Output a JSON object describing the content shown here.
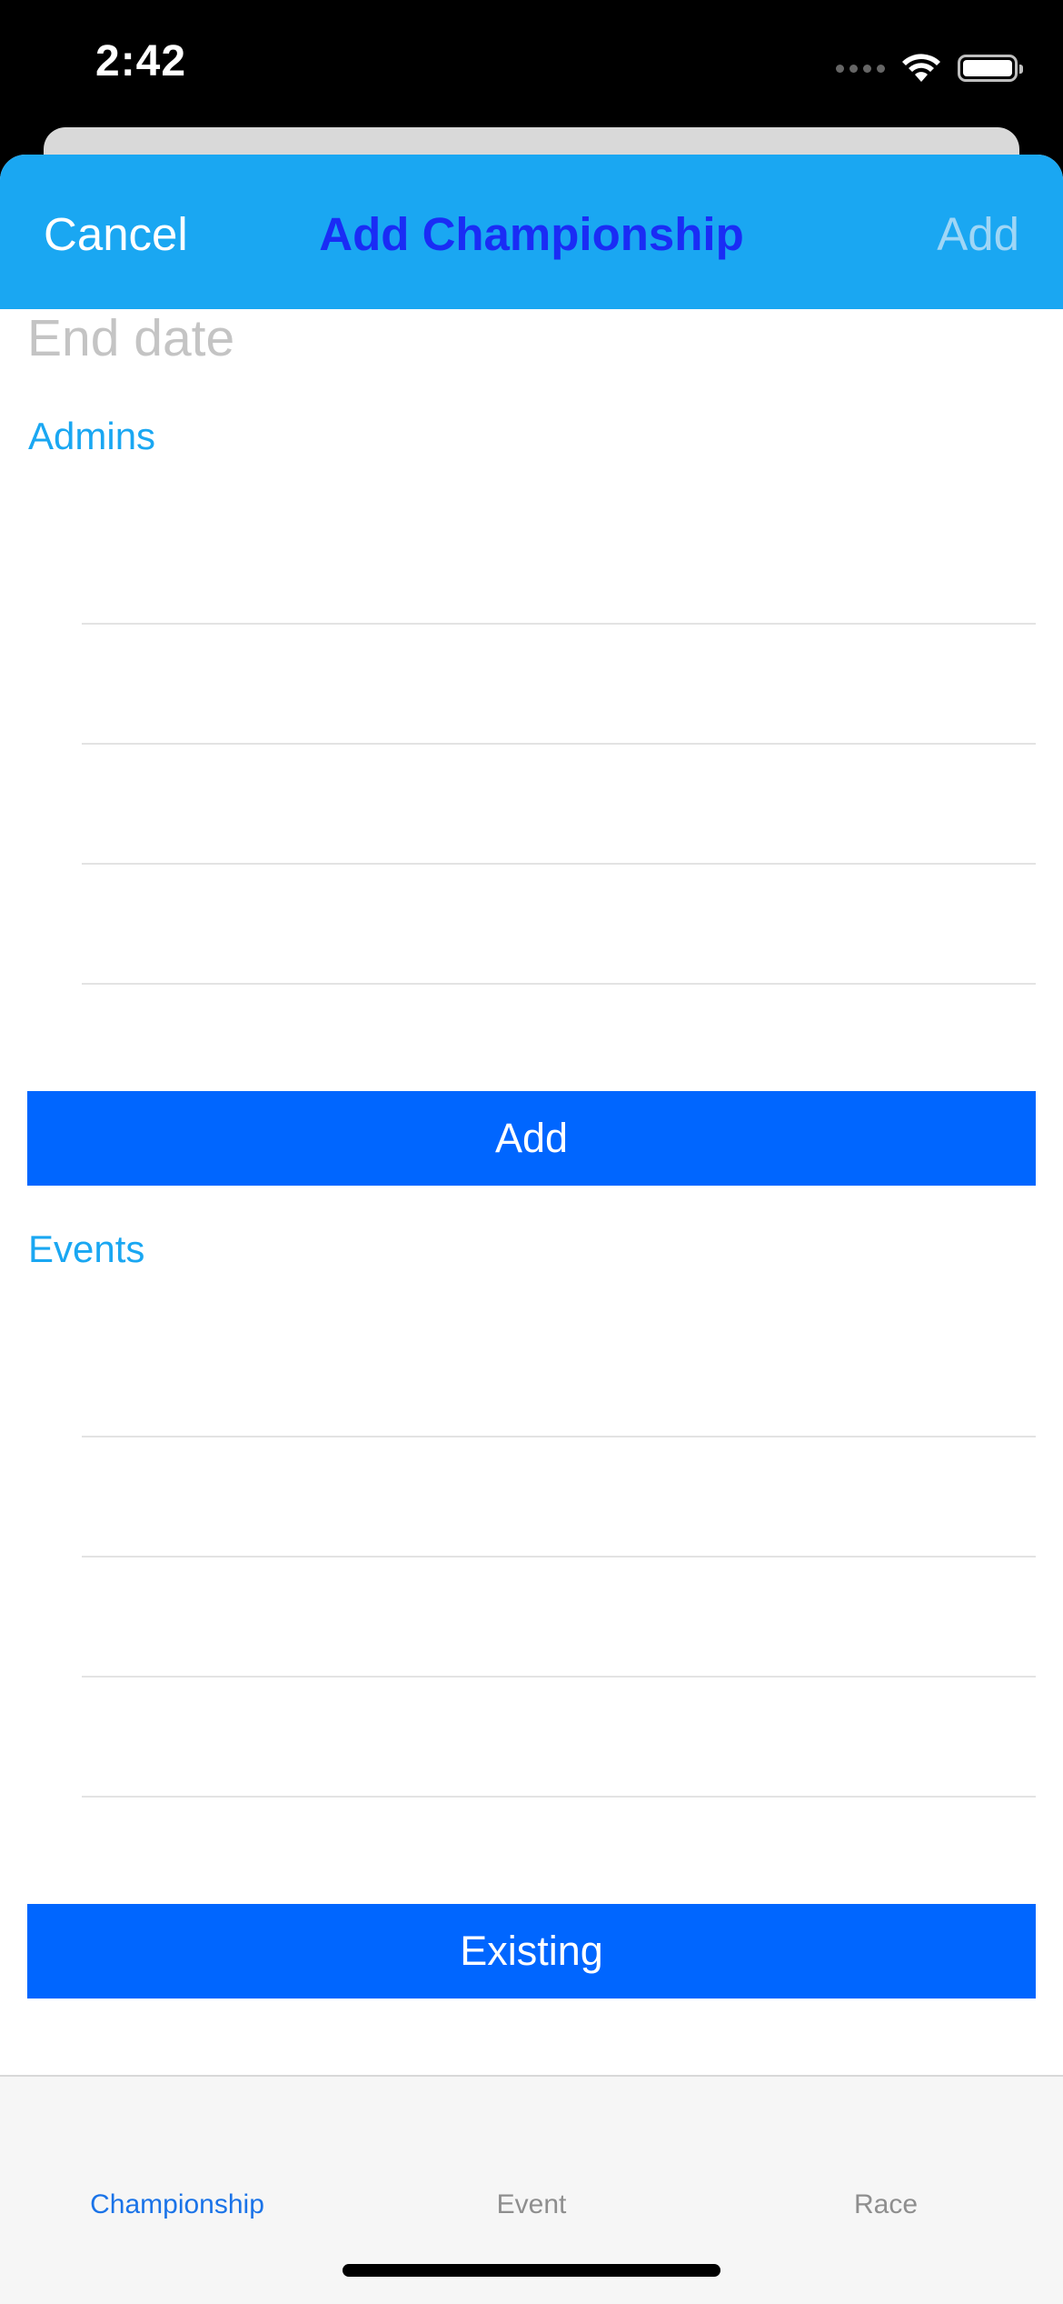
{
  "status_bar": {
    "time": "2:42",
    "icons": [
      "signal-dots-icon",
      "wifi-icon",
      "battery-icon"
    ]
  },
  "nav": {
    "cancel_label": "Cancel",
    "title": "Add Championship",
    "add_label": "Add"
  },
  "form": {
    "end_date_placeholder": "End date",
    "admins": {
      "header": "Admins",
      "rows": [
        "",
        "",
        "",
        ""
      ],
      "button_label": "Add"
    },
    "events": {
      "header": "Events",
      "rows": [
        "",
        "",
        "",
        ""
      ],
      "button_label": "Existing"
    }
  },
  "tabs": [
    {
      "label": "Championship",
      "active": true
    },
    {
      "label": "Event",
      "active": false
    },
    {
      "label": "Race",
      "active": false
    }
  ],
  "colors": {
    "nav_background": "#1aa7f2",
    "title": "#1a2cf5",
    "button": "#0066ff",
    "section_header": "#1aa7f2",
    "active_tab": "#1a73e8"
  }
}
